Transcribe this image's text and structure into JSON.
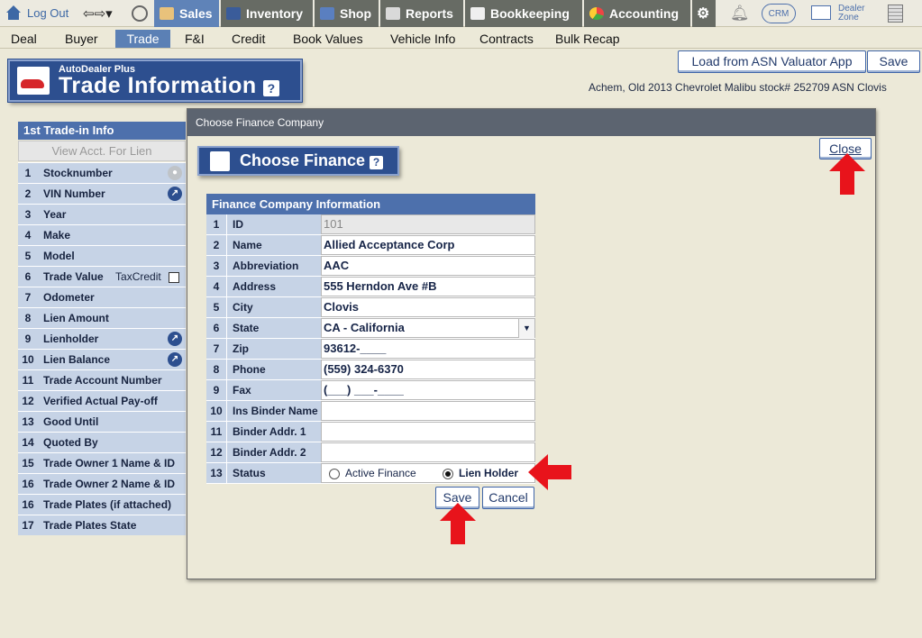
{
  "topnav": {
    "logout": "Log Out",
    "tabs": [
      {
        "label": "Sales",
        "icon": "salesperson-icon"
      },
      {
        "label": "Inventory",
        "icon": "car-icon"
      },
      {
        "label": "Shop",
        "icon": "wrench-icon"
      },
      {
        "label": "Reports",
        "icon": "report-icon"
      },
      {
        "label": "Bookkeeping",
        "icon": "book-icon"
      },
      {
        "label": "Accounting",
        "icon": "pie-chart-icon"
      }
    ],
    "crm": "CRM",
    "dealer_zone": "Dealer Zone"
  },
  "subnav": {
    "items": [
      "Deal",
      "Buyer",
      "Trade",
      "F&I",
      "Credit",
      "Book Values",
      "Vehicle Info",
      "Contracts",
      "Bulk Recap"
    ],
    "selected": "Trade"
  },
  "header": {
    "load_button": "Load from ASN Valuator App",
    "save_button": "Save",
    "logo_small": "AutoDealer Plus",
    "logo_title": "Trade Information",
    "help": "?",
    "deal_info": "Achem,  Old   2013 Chevrolet Malibu   stock# 252709  ASN Clovis"
  },
  "trade_panel": {
    "title": "1st Trade-in Info",
    "view_acct": "View Acct. For Lien",
    "rows": [
      {
        "n": "1",
        "label": "Stocknumber"
      },
      {
        "n": "2",
        "label": "VIN Number"
      },
      {
        "n": "3",
        "label": "Year"
      },
      {
        "n": "4",
        "label": "Make"
      },
      {
        "n": "5",
        "label": "Model"
      },
      {
        "n": "6",
        "label": "Trade Value",
        "extra": "TaxCredit"
      },
      {
        "n": "7",
        "label": "Odometer"
      },
      {
        "n": "8",
        "label": "Lien Amount"
      },
      {
        "n": "9",
        "label": "Lienholder"
      },
      {
        "n": "10",
        "label": "Lien Balance"
      },
      {
        "n": "11",
        "label": "Trade Account Number"
      },
      {
        "n": "12",
        "label": "Verified Actual Pay-off"
      },
      {
        "n": "13",
        "label": "Good Until"
      },
      {
        "n": "14",
        "label": "Quoted By"
      },
      {
        "n": "15",
        "label": "Trade Owner 1 Name & ID"
      },
      {
        "n": "16",
        "label": "Trade Owner 2 Name & ID"
      },
      {
        "n": "16",
        "label": "Trade Plates (if attached)"
      },
      {
        "n": "17",
        "label": "Trade Plates State"
      }
    ]
  },
  "modal": {
    "title": "Choose Finance Company",
    "logo_title": "Choose Finance",
    "help": "?",
    "close": "Close",
    "table_title": "Finance Company Information",
    "rows": [
      {
        "n": "1",
        "label": "ID",
        "value": "101"
      },
      {
        "n": "2",
        "label": "Name",
        "value": "Allied Acceptance Corp"
      },
      {
        "n": "3",
        "label": "Abbreviation",
        "value": "AAC"
      },
      {
        "n": "4",
        "label": "Address",
        "value": "555 Herndon Ave #B"
      },
      {
        "n": "5",
        "label": "City",
        "value": "Clovis"
      },
      {
        "n": "6",
        "label": "State",
        "value": "CA - California"
      },
      {
        "n": "7",
        "label": "Zip",
        "value": "93612-____"
      },
      {
        "n": "8",
        "label": "Phone",
        "value": "(559) 324-6370"
      },
      {
        "n": "9",
        "label": "Fax",
        "value": "(___) ___-____"
      },
      {
        "n": "10",
        "label": "Ins Binder Name",
        "value": ""
      },
      {
        "n": "11",
        "label": "Binder Addr. 1",
        "value": ""
      },
      {
        "n": "12",
        "label": "Binder Addr. 2",
        "value": ""
      },
      {
        "n": "13",
        "label": "Status",
        "value": ""
      }
    ],
    "status_options": [
      "Active Finance",
      "Lien Holder"
    ],
    "status_selected": "Lien Holder",
    "save": "Save",
    "cancel": "Cancel"
  },
  "colors": {
    "accent": "#4d70ac",
    "annotation_arrow": "#e8131b"
  }
}
